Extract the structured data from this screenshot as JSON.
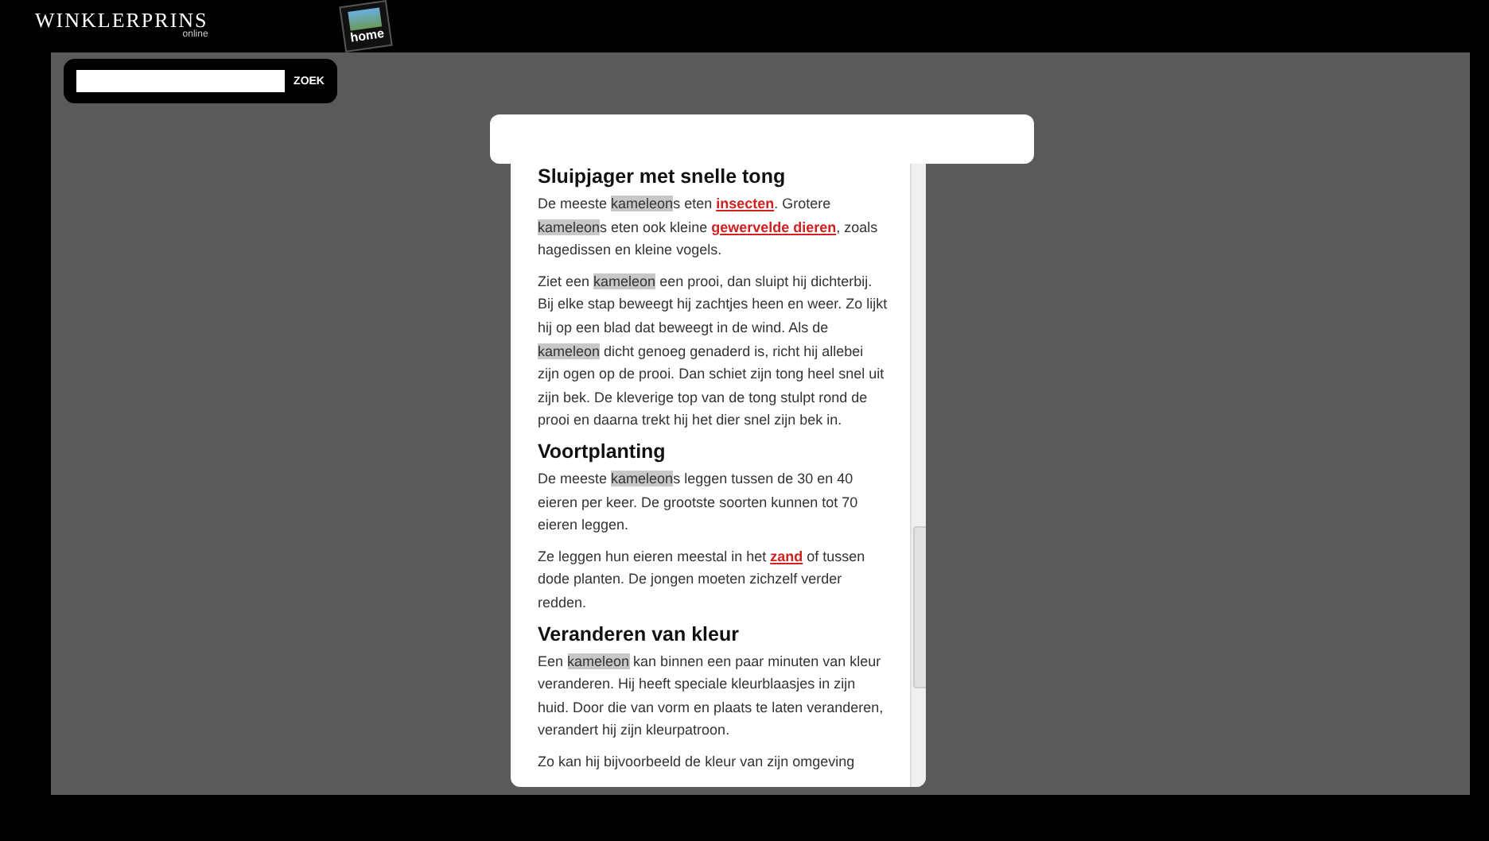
{
  "header": {
    "logo": "WINKLERPRINS",
    "logo_sub": "online",
    "home_label": "home"
  },
  "search": {
    "button": "ZOEK"
  },
  "article": {
    "sections": [
      {
        "heading": "Sluipjager met snelle tong",
        "paragraphs": [
          [
            {
              "kind": "plain",
              "text": "De meeste "
            },
            {
              "kind": "highlight",
              "text": "kameleon"
            },
            {
              "kind": "plain",
              "text": "s eten "
            },
            {
              "kind": "link",
              "text": "insecten"
            },
            {
              "kind": "plain",
              "text": ". Grotere "
            },
            {
              "kind": "highlight",
              "text": "kameleon"
            },
            {
              "kind": "plain",
              "text": "s eten ook kleine "
            },
            {
              "kind": "link",
              "text": "gewervelde dieren"
            },
            {
              "kind": "plain",
              "text": ", zoals hagedissen en kleine vogels."
            }
          ],
          [
            {
              "kind": "plain",
              "text": "Ziet een "
            },
            {
              "kind": "highlight",
              "text": "kameleon"
            },
            {
              "kind": "plain",
              "text": " een prooi, dan sluipt hij dichterbij. Bij elke stap beweegt hij zachtjes heen en weer. Zo lijkt hij op een blad dat beweegt in de wind. Als de "
            },
            {
              "kind": "highlight",
              "text": "kameleon"
            },
            {
              "kind": "plain",
              "text": " dicht genoeg genaderd is, richt hij allebei zijn ogen op de prooi. Dan schiet zijn tong heel snel uit zijn bek. De kleverige top van de tong stulpt rond de prooi en daarna trekt hij het dier snel zijn bek in."
            }
          ]
        ]
      },
      {
        "heading": "Voortplanting",
        "paragraphs": [
          [
            {
              "kind": "plain",
              "text": "De meeste "
            },
            {
              "kind": "highlight",
              "text": "kameleon"
            },
            {
              "kind": "plain",
              "text": "s leggen tussen de 30 en 40 eieren per keer. De grootste soorten kunnen tot 70 eieren leggen."
            }
          ],
          [
            {
              "kind": "plain",
              "text": "Ze leggen hun eieren meestal in het "
            },
            {
              "kind": "link",
              "text": "zand"
            },
            {
              "kind": "plain",
              "text": " of tussen dode planten. De jongen moeten zichzelf verder redden."
            }
          ]
        ]
      },
      {
        "heading": "Veranderen van kleur",
        "paragraphs": [
          [
            {
              "kind": "plain",
              "text": "Een "
            },
            {
              "kind": "highlight",
              "text": "kameleon"
            },
            {
              "kind": "plain",
              "text": " kan binnen een paar minuten van kleur veranderen. Hij heeft speciale kleurblaasjes in zijn huid. Door die van vorm en plaats te laten veranderen, verandert hij zijn kleurpatroon."
            }
          ],
          [
            {
              "kind": "plain",
              "text": "Zo kan hij bijvoorbeeld de kleur van zijn omgeving"
            }
          ]
        ]
      }
    ]
  }
}
